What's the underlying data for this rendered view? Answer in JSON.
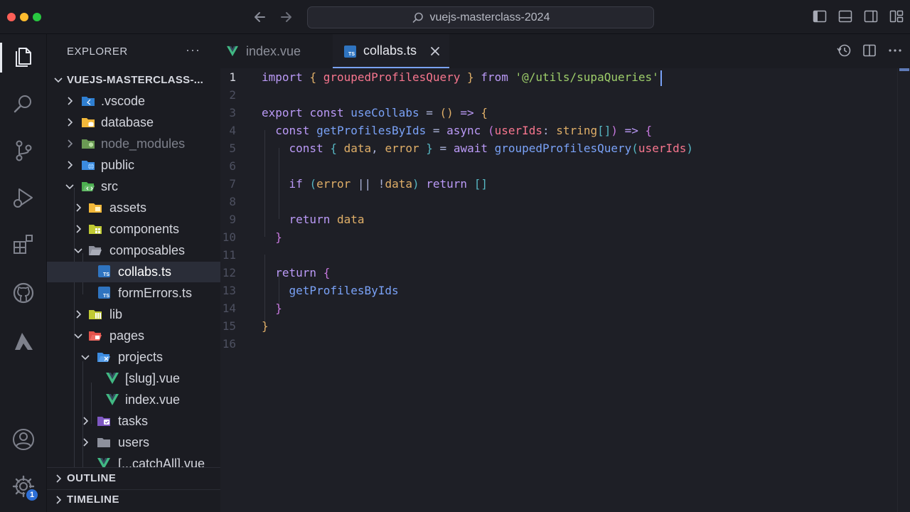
{
  "window": {
    "title": "vuejs-masterclass-2024"
  },
  "sidebar": {
    "header": "EXPLORER",
    "more": "···",
    "root": "VUEJS-MASTERCLASS-...",
    "items": [
      {
        "label": ".vscode"
      },
      {
        "label": "database"
      },
      {
        "label": "node_modules"
      },
      {
        "label": "public"
      },
      {
        "label": "src"
      },
      {
        "label": "assets"
      },
      {
        "label": "components"
      },
      {
        "label": "composables"
      },
      {
        "label": "collabs.ts"
      },
      {
        "label": "formErrors.ts"
      },
      {
        "label": "lib"
      },
      {
        "label": "pages"
      },
      {
        "label": "projects"
      },
      {
        "label": "[slug].vue"
      },
      {
        "label": "index.vue"
      },
      {
        "label": "tasks"
      },
      {
        "label": "users"
      },
      {
        "label": "[...catchAll].vue"
      }
    ],
    "sections": [
      {
        "label": "OUTLINE"
      },
      {
        "label": "TIMELINE"
      }
    ]
  },
  "activity": {
    "badge_count": "1"
  },
  "editor": {
    "tabs": [
      {
        "label": "index.vue"
      },
      {
        "label": "collabs.ts"
      }
    ],
    "line_numbers": [
      "1",
      "2",
      "3",
      "4",
      "5",
      "6",
      "7",
      "8",
      "9",
      "10",
      "11",
      "12",
      "13",
      "14",
      "15",
      "16"
    ]
  },
  "colors": {
    "accent": "#7aa2f7",
    "background": "#1e1f26",
    "badge": "#2d6fd6"
  }
}
